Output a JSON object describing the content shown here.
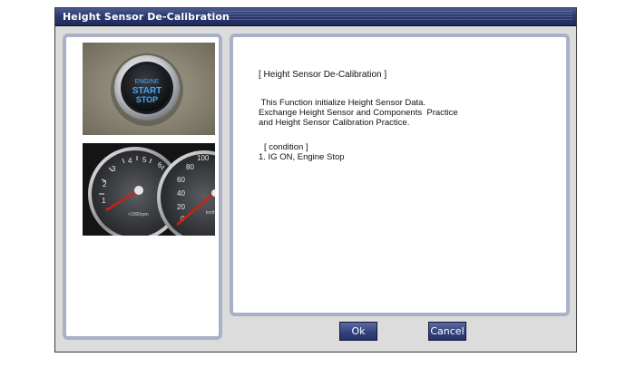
{
  "window": {
    "title": "Height Sensor De-Calibration"
  },
  "content": {
    "heading": "[ Height Sensor De-Calibration ]",
    "description_lines": [
      " This Function initialize Height Sensor Data.",
      "Exchange Height Sensor and Components  Practice",
      "and Height Sensor Calibration Practice."
    ],
    "condition_heading": "[ condition ]",
    "condition_items": [
      "1. IG ON, Engine Stop"
    ]
  },
  "images": {
    "start_button": {
      "icon": "engine-start-stop-button-image",
      "line1": "ENGINE",
      "line2": "START",
      "line3": "STOP"
    },
    "gauge": {
      "icon": "instrument-cluster-image"
    }
  },
  "buttons": {
    "ok": "Ok",
    "cancel": "Cancel"
  },
  "colors": {
    "titlebar": "#2c3a70",
    "panel_border": "#aab0c8",
    "button": "#33427d",
    "window_bg": "#dcdcdc"
  }
}
